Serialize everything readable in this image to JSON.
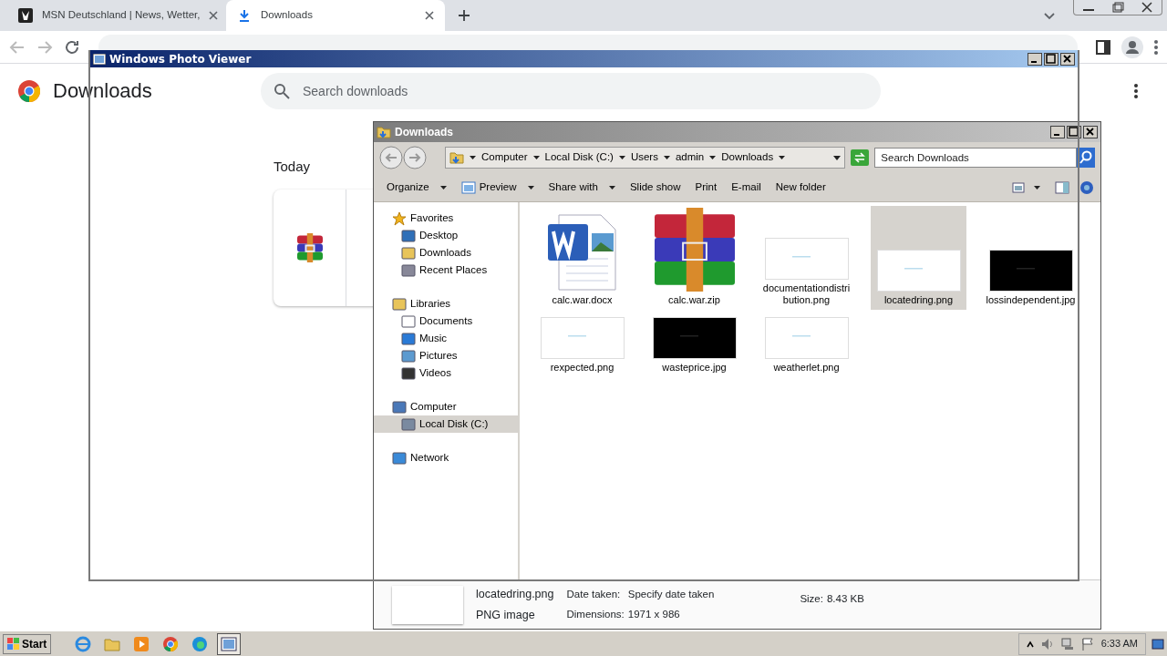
{
  "browser": {
    "tabs": [
      {
        "title": "MSN Deutschland | News, Wetter,",
        "kind": "msn",
        "selected": false
      },
      {
        "title": "Downloads",
        "kind": "download",
        "selected": true
      }
    ]
  },
  "downloads_page": {
    "title": "Downloads",
    "search": {
      "placeholder": "Search downloads"
    },
    "date_group": "Today"
  },
  "photo_viewer": {
    "title": "Windows Photo Viewer"
  },
  "explorer": {
    "title": "Downloads",
    "breadcrumb": [
      "Computer",
      "Local Disk (C:)",
      "Users",
      "admin",
      "Downloads"
    ],
    "search": {
      "placeholder": "Search Downloads"
    },
    "toolbar": [
      {
        "label": "Organize",
        "dropdown": true,
        "kind": "text"
      },
      {
        "label": "Preview",
        "dropdown": true,
        "kind": "preview"
      },
      {
        "label": "Share with",
        "dropdown": true,
        "kind": "text"
      },
      {
        "label": "Slide show",
        "dropdown": false,
        "kind": "text"
      },
      {
        "label": "Print",
        "dropdown": false,
        "kind": "text"
      },
      {
        "label": "E-mail",
        "dropdown": false,
        "kind": "text"
      },
      {
        "label": "New folder",
        "dropdown": false,
        "kind": "text"
      }
    ],
    "nav": [
      {
        "label": "Favorites",
        "kind": "star",
        "selected": false,
        "children": [
          {
            "label": "Desktop",
            "kind": "desktop",
            "selected": false
          },
          {
            "label": "Downloads",
            "kind": "folder",
            "selected": false
          },
          {
            "label": "Recent Places",
            "kind": "places",
            "selected": false
          }
        ]
      },
      {
        "label": "Libraries",
        "kind": "library",
        "selected": false,
        "children": [
          {
            "label": "Documents",
            "kind": "docs",
            "selected": false
          },
          {
            "label": "Music",
            "kind": "music",
            "selected": false
          },
          {
            "label": "Pictures",
            "kind": "pictures",
            "selected": false
          },
          {
            "label": "Videos",
            "kind": "videos",
            "selected": false
          }
        ]
      },
      {
        "label": "Computer",
        "kind": "computer",
        "selected": false,
        "children": [
          {
            "label": "Local Disk (C:)",
            "kind": "disk",
            "selected": true
          }
        ]
      },
      {
        "label": "Network",
        "kind": "network",
        "selected": false
      }
    ],
    "files": [
      {
        "name": "calc.war.docx",
        "kind": "docx",
        "selected": false
      },
      {
        "name": "calc.war.zip",
        "kind": "zip",
        "selected": false
      },
      {
        "name": "documentationdistribution.png",
        "kind": "light",
        "selected": false
      },
      {
        "name": "locatedring.png",
        "kind": "light",
        "selected": true
      },
      {
        "name": "lossindependent.jpg",
        "kind": "dark",
        "selected": false
      },
      {
        "name": "rexpected.png",
        "kind": "light",
        "selected": false
      },
      {
        "name": "wasteprice.jpg",
        "kind": "dark",
        "selected": false
      },
      {
        "name": "weatherlet.png",
        "kind": "light",
        "selected": false
      }
    ],
    "details": {
      "name": "locatedring.png",
      "type": "PNG image",
      "fields": [
        {
          "label": "Date taken:",
          "value": "Specify date taken"
        },
        {
          "label": "Dimensions:",
          "value": "1971 x 986"
        },
        {
          "label": "Size:",
          "value": "8.43 KB"
        }
      ]
    }
  },
  "taskbar": {
    "start": "Start",
    "apps": [
      {
        "kind": "ie",
        "active": false
      },
      {
        "kind": "explorer",
        "active": false
      },
      {
        "kind": "media",
        "active": false
      },
      {
        "kind": "chrome",
        "active": false
      },
      {
        "kind": "edge",
        "active": false
      },
      {
        "kind": "photos",
        "active": true
      }
    ],
    "clock": "6:33 AM"
  }
}
